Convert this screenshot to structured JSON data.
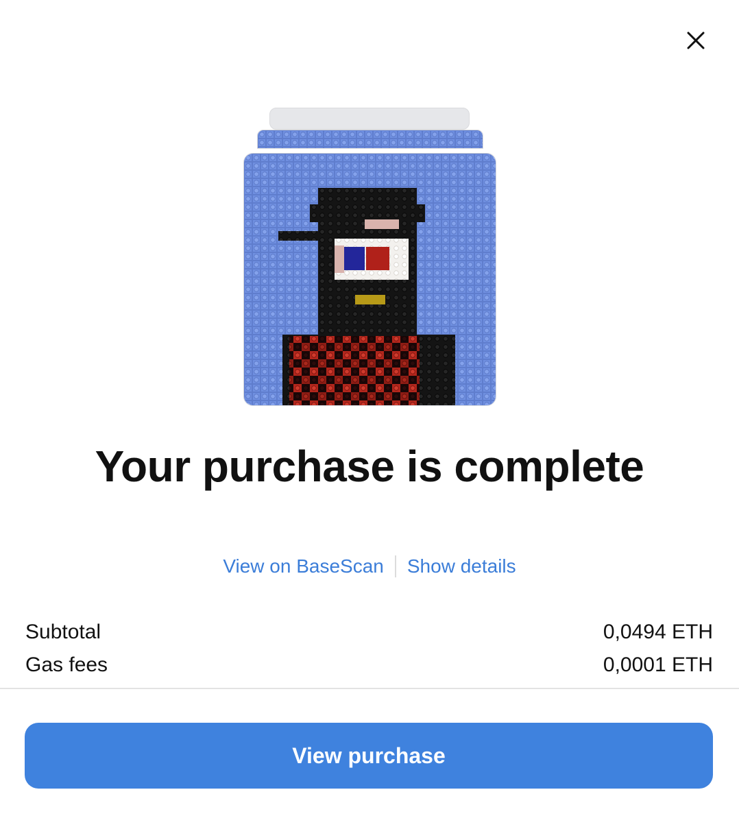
{
  "dialog": {
    "close_icon": "close-icon",
    "title": "Your purchase is complete",
    "links": {
      "explorer": "View on BaseScan",
      "details": "Show details"
    },
    "summary": [
      {
        "label": "Subtotal",
        "value": "0,0494 ETH"
      },
      {
        "label": "Gas fees",
        "value": "0,0001 ETH"
      }
    ],
    "primary_button": "View purchase"
  },
  "colors": {
    "accent": "#3f82de",
    "link": "#3b7dd8",
    "nft_background": "#6f8fe0"
  }
}
